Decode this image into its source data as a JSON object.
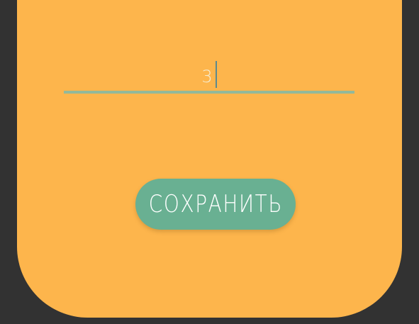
{
  "theme": {
    "background": "#323232",
    "card": "#fdb54c",
    "accent": "#69b092",
    "underline": "#93b99a",
    "input_text": "#f6ecd0"
  },
  "form": {
    "input_value": "3",
    "save_label": "СОХРАНИТЬ"
  }
}
